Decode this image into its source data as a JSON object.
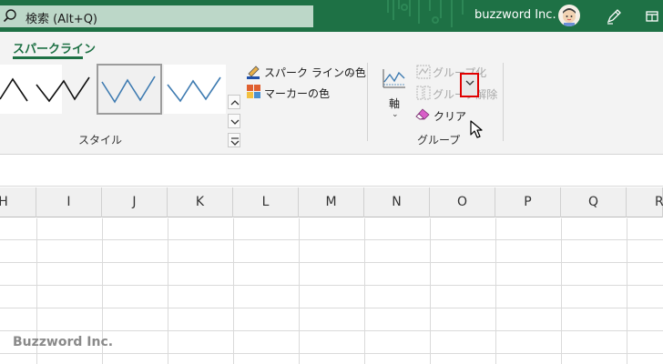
{
  "titlebar": {
    "search_placeholder": "検索 (Alt+Q)",
    "user_name": "buzzword Inc.",
    "bg_color": "#1e7145"
  },
  "ribbon": {
    "active_tab": "スパークライン",
    "style_group": {
      "label": "スタイル",
      "sparkline_color_label": "スパーク ラインの色",
      "marker_color_label": "マーカーの色"
    },
    "group_group": {
      "label": "グループ",
      "axis_label": "軸",
      "group_label": "グループ化",
      "ungroup_label": "グループ解除",
      "clear_label": "クリア"
    }
  },
  "sheet": {
    "columns": [
      "H",
      "I",
      "J",
      "K",
      "L",
      "M",
      "N",
      "O",
      "P",
      "Q",
      "R"
    ]
  },
  "watermark": "Buzzword Inc.",
  "icons": [
    "search-icon",
    "user-avatar",
    "pen-icon",
    "restore-window-icon",
    "axis-icon",
    "group-icon",
    "ungroup-icon",
    "eraser-icon",
    "chevron-down-icon",
    "mouse-cursor-icon"
  ]
}
